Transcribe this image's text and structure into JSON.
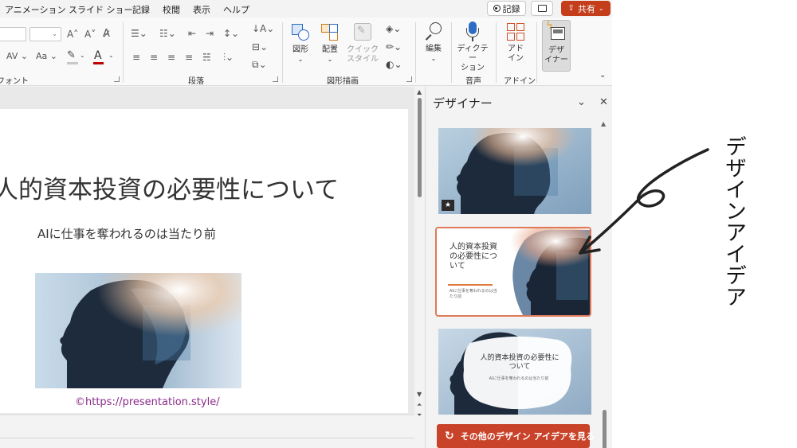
{
  "menubar": {
    "tabs": [
      "アニメーション",
      "スライド ショー",
      "記録",
      "校閲",
      "表示",
      "ヘルプ"
    ],
    "record_label": "記録",
    "share_label": "共有",
    "accent": "#c43e1c"
  },
  "ribbon": {
    "font_group_label": "フォント",
    "paragraph_group_label": "段落",
    "drawing_group_label": "図形描画",
    "voice_group_label": "音声",
    "addin_group_label": "アドイン",
    "shapes_label": "図形",
    "arrange_label": "配置",
    "quick_style_label": [
      "クイック",
      "スタイル"
    ],
    "edit_label": "編集",
    "dictate_label": [
      "ディクテー",
      "ション"
    ],
    "addin_label": [
      "アド",
      "イン"
    ],
    "designer_label": [
      "デザ",
      "イナー"
    ]
  },
  "slide": {
    "title": "人的資本投資の必要性について",
    "subtitle": "AIに仕事を奪われるのは当たり前",
    "credit": "©https://presentation.style/"
  },
  "designer_pane": {
    "title": "デザイナー",
    "card2": {
      "title": "人的資本投資の必要性について",
      "subtitle": "AIに仕事を奪われるのは当たり前"
    },
    "card3": {
      "title": "人的資本投資の必要性について",
      "subtitle": "AIに仕事を奪われるのは当たり前"
    },
    "more_button": "その他のデザイン アイデアを見る",
    "accent": "#c8432a"
  },
  "annotation": {
    "text": "デザインアイデア"
  }
}
